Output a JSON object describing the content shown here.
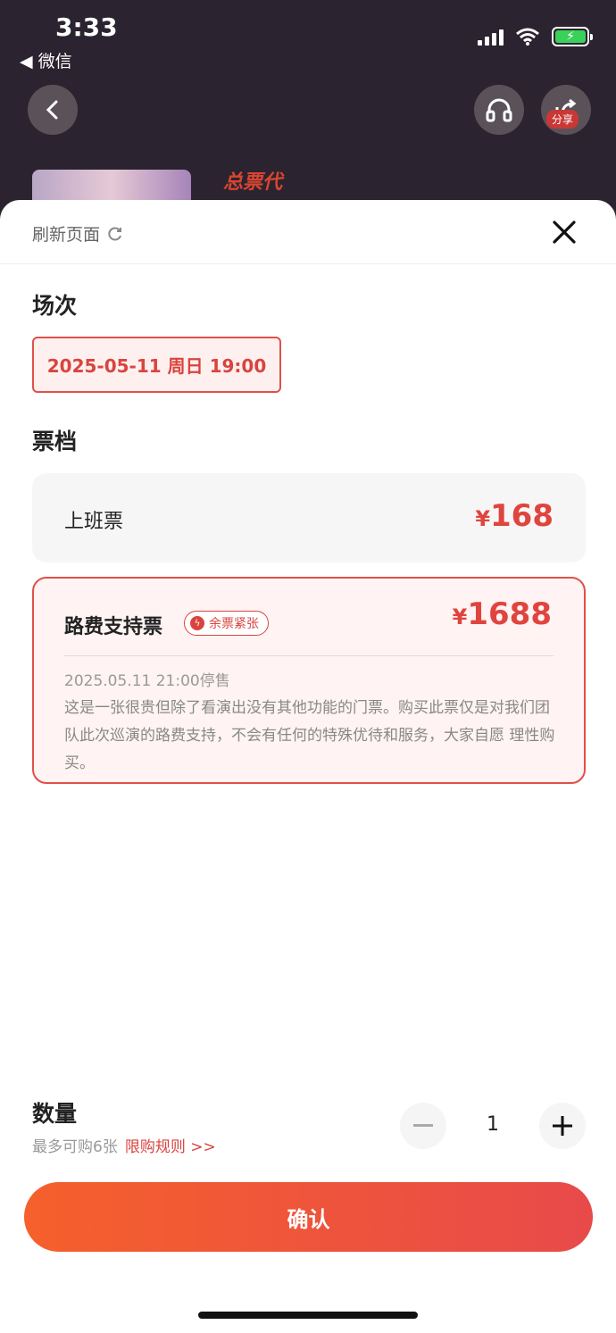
{
  "status_bar": {
    "time": "3:33",
    "back_app": "◀ 微信"
  },
  "header": {
    "share_label": "分享",
    "promo_logo": "总票代"
  },
  "sheet": {
    "refresh_label": "刷新页面",
    "session": {
      "title": "场次",
      "selected": "2025-05-11 周日 19:00"
    },
    "tier": {
      "title": "票档",
      "tickets": [
        {
          "name": "上班票",
          "currency": "¥",
          "price": "168"
        },
        {
          "name": "路费支持票",
          "currency": "¥",
          "price": "1688",
          "badge": "余票紧张",
          "stop_time": "2025.05.11 21:00停售",
          "description": "这是一张很贵但除了看演出没有其他功能的门票。购买此票仅是对我们团队此次巡演的路费支持，不会有任何的特殊优待和服务，大家自愿 理性购买。"
        }
      ]
    },
    "quantity": {
      "title": "数量",
      "limit": "最多可购6张",
      "rule_link": "限购规则 >>",
      "value": "1"
    },
    "confirm_label": "确认"
  },
  "colors": {
    "accent": "#e0443e",
    "button_start": "#f5602c",
    "button_end": "#e84a4a"
  }
}
